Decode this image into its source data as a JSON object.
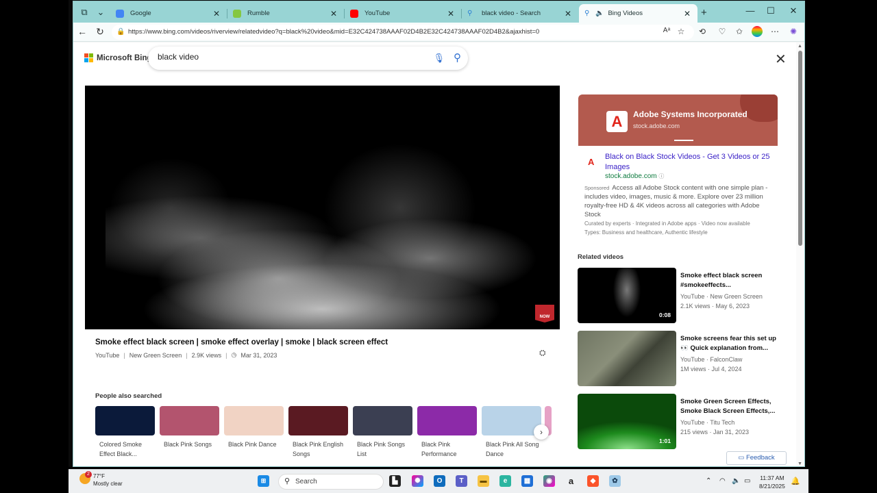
{
  "tabs": [
    {
      "label": "Google",
      "favicon_color": "#4285f4"
    },
    {
      "label": "Rumble",
      "favicon_color": "#85c742"
    },
    {
      "label": "YouTube",
      "favicon_color": "#ff0000"
    },
    {
      "label": "black video - Search",
      "favicon_color": "#2a7fd4"
    },
    {
      "label": "Bing Videos",
      "favicon_color": "#2a7fd4",
      "active": true
    }
  ],
  "address": {
    "url": "https://www.bing.com/videos/riverview/relatedvideo?q=black%20video&mid=E32C424738AAAF02D4B2E32C424738AAAF02D4B2&ajaxhist=0"
  },
  "bing": {
    "logo_text": "Microsoft Bing",
    "query": "black video"
  },
  "video": {
    "title": "Smoke effect black screen | smoke effect overlay | smoke | black screen effect",
    "source": "YouTube",
    "channel": "New Green Screen",
    "views": "2.9K views",
    "date": "Mar 31, 2023",
    "badge": "NOW"
  },
  "people_also_searched": {
    "heading": "People also searched",
    "items": [
      {
        "label": "Colored Smoke Effect Black...",
        "color": "#0b1a3a"
      },
      {
        "label": "Black Pink Songs",
        "color": "#b3546e"
      },
      {
        "label": "Black Pink Dance",
        "color": "#f1d3c4"
      },
      {
        "label": "Black Pink English Songs",
        "color": "#5a1a22"
      },
      {
        "label": "Black Pink Songs List",
        "color": "#3b3f52"
      },
      {
        "label": "Black Pink Performance",
        "color": "#8c2aa8"
      },
      {
        "label": "Black Pink All Song Dance",
        "color": "#b9d3e8"
      }
    ]
  },
  "ad": {
    "banner_name": "Adobe Systems Incorporated",
    "banner_domain": "stock.adobe.com",
    "link": "Black on Black Stock Videos - Get 3 Videos or 25 Images",
    "url": "stock.adobe.com",
    "sponsored": "Sponsored",
    "description": "Access all Adobe Stock content with one simple plan - includes video, images, music & more. Explore over 23 million royalty-free HD & 4K videos across all categories with Adobe Stock",
    "sub1": "Curated by experts · Integrated in Adobe apps · Video now available",
    "sub2": "Types: Business and healthcare, Authentic lifestyle",
    "logo_letter": "A"
  },
  "related": {
    "heading": "Related videos",
    "items": [
      {
        "title": "Smoke effect black screen #smokeeffects...",
        "source": "YouTube · New Green Screen",
        "meta": "2.1K views · May 6, 2023",
        "duration": "0:08",
        "thumb": "smoke"
      },
      {
        "title": "Smoke screens fear this set up 👀 Quick explanation from...",
        "source": "YouTube · FalconClaw",
        "meta": "1M views · Jul 4, 2024",
        "duration": "",
        "thumb": "rifle"
      },
      {
        "title": "Smoke Green Screen Effects, Smoke Black Screen Effects,...",
        "source": "YouTube · Titu Tech",
        "meta": "215 views · Jan 31, 2023",
        "duration": "1:01",
        "thumb": "green"
      }
    ]
  },
  "feedback_label": "Feedback",
  "taskbar": {
    "temp": "77°F",
    "weather": "Mostly clear",
    "badge": "2",
    "search_placeholder": "Search",
    "time": "11:37 AM",
    "date": "8/21/2025"
  }
}
